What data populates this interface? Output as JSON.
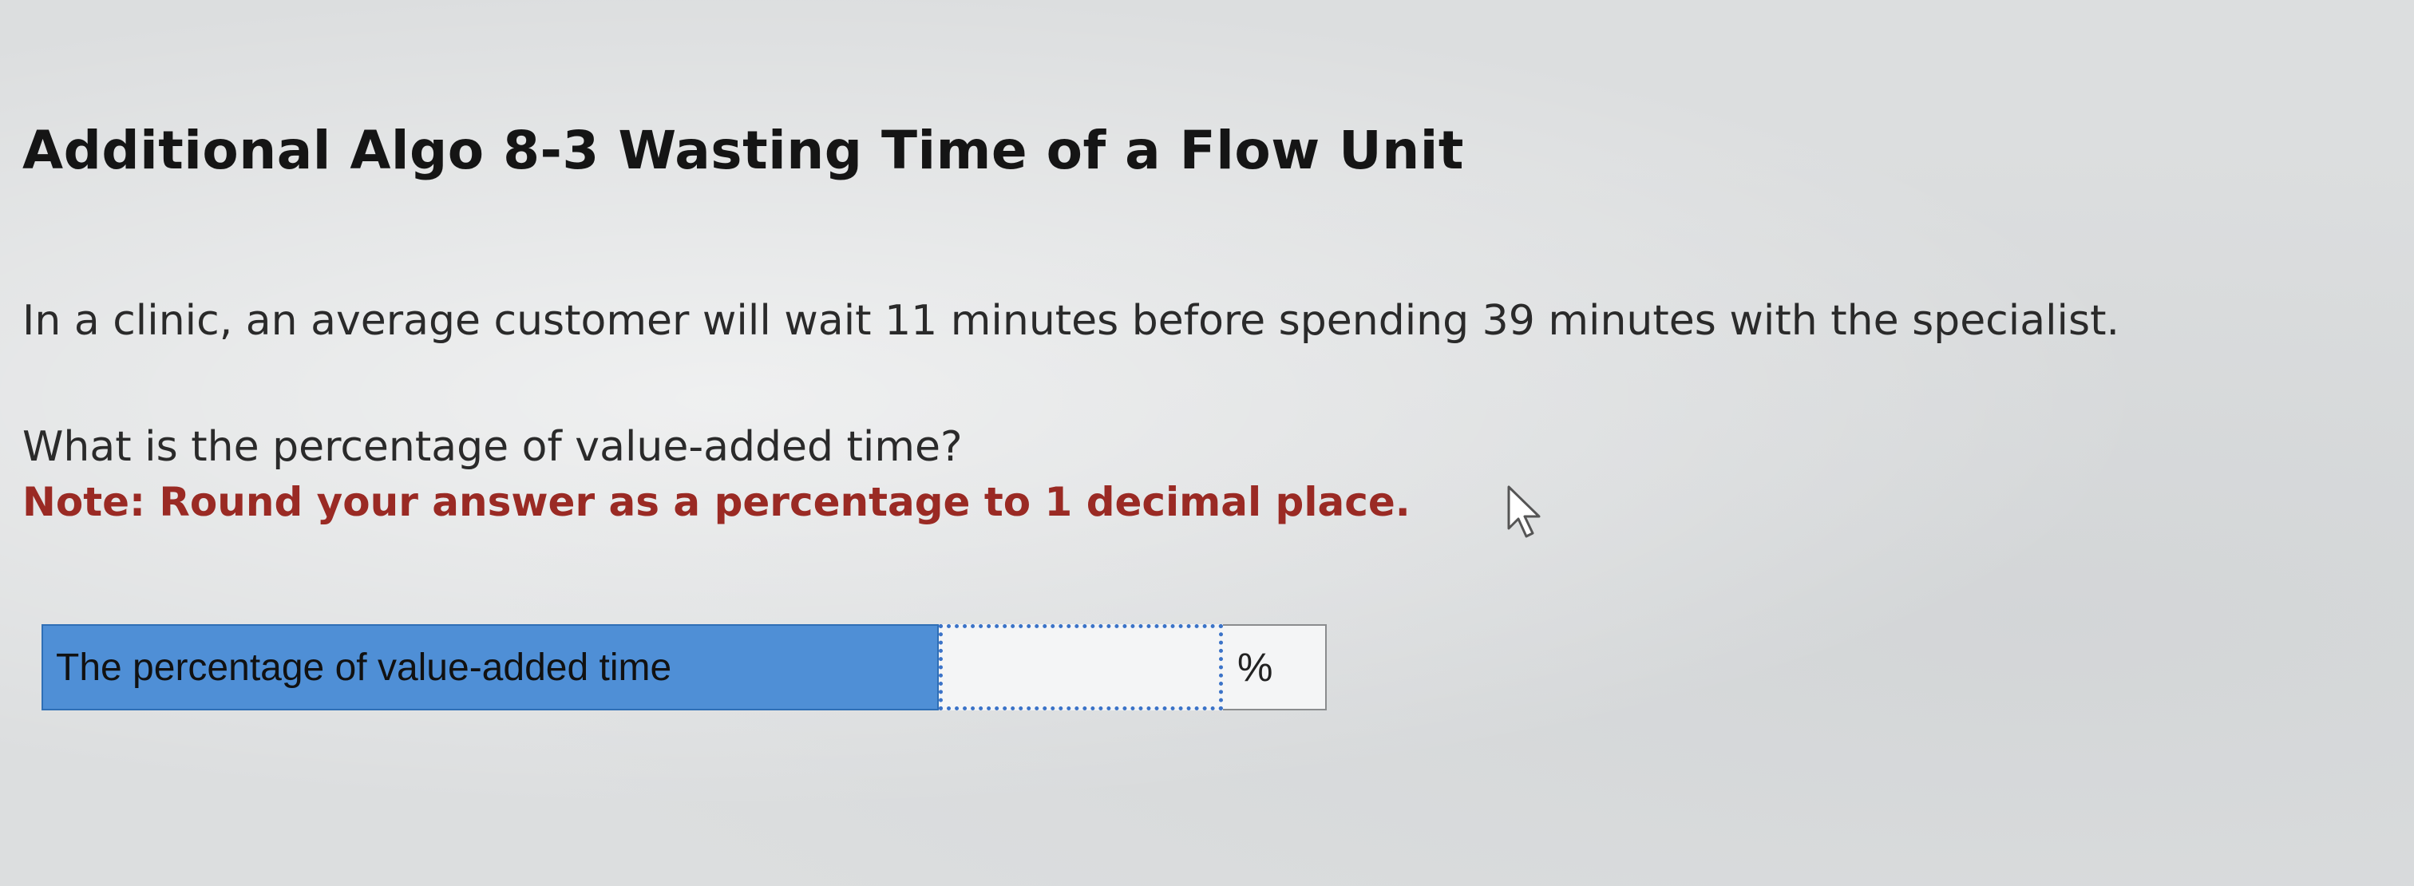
{
  "problem": {
    "title": "Additional Algo 8-3 Wasting Time of a Flow Unit",
    "question_text": "In a clinic, an average customer will wait 11 minutes before spending 39 minutes with the specialist.",
    "prompt_text": "What is the percentage of value-added time?",
    "note_text": "Note: Round your answer as a percentage to 1 decimal place."
  },
  "answer": {
    "label": "The percentage of value-added time",
    "input_value": "",
    "unit": "%"
  },
  "colors": {
    "note_red": "#9a2a24",
    "label_cell_blue": "#4f8fd6",
    "input_border_blue": "#3b73c8"
  },
  "icons": {
    "cursor": "mouse-pointer-icon"
  }
}
